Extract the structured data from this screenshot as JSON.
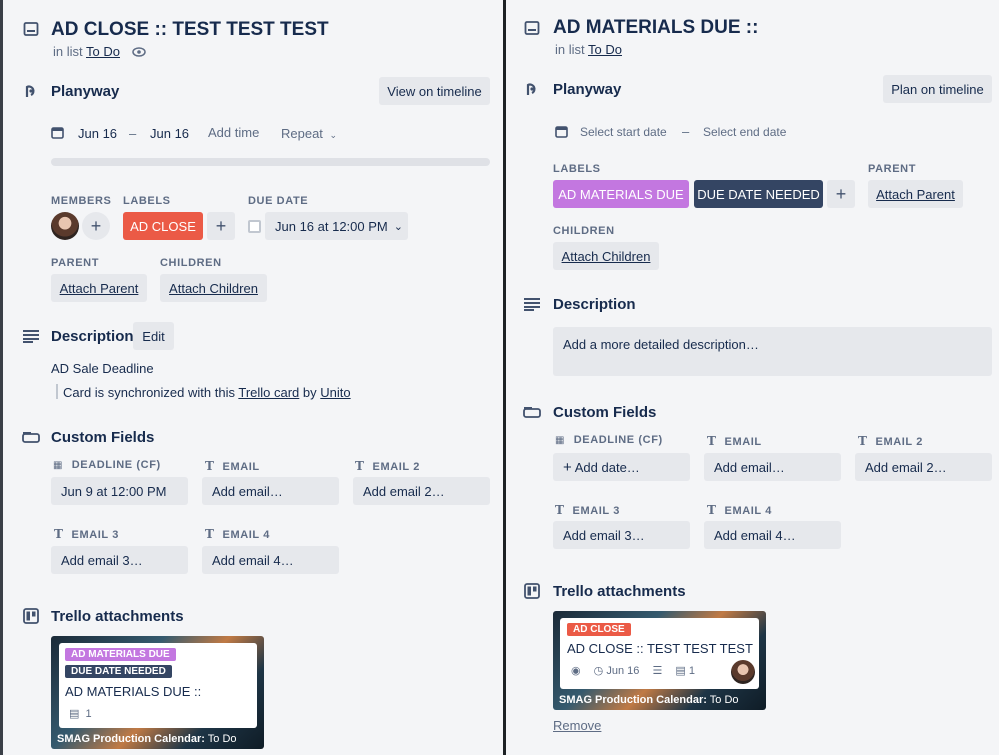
{
  "left": {
    "title": "AD CLOSE :: TEST TEST TEST",
    "in_list_prefix": "in list",
    "list_name": "To Do",
    "planyway": {
      "heading": "Planyway",
      "view_button": "View on timeline",
      "start": "Jun 16",
      "dash": "–",
      "end": "Jun 16",
      "add_time": "Add time",
      "repeat": "Repeat"
    },
    "members_label": "MEMBERS",
    "labels_label": "LABELS",
    "due_label": "DUE DATE",
    "label_chip": "AD CLOSE",
    "due_value": "Jun 16 at 12:00 PM",
    "parent_label": "PARENT",
    "children_label": "CHILDREN",
    "attach_parent": "Attach Parent",
    "attach_children": "Attach Children",
    "description": {
      "heading": "Description",
      "edit": "Edit",
      "line1": "AD Sale Deadline",
      "sync_prefix": "Card is synchronized with this",
      "sync_link": "Trello card",
      "sync_by": "by",
      "sync_service": "Unito"
    },
    "custom_fields": {
      "heading": "Custom Fields",
      "deadline_label": "DEADLINE (CF)",
      "deadline_value": "Jun 9 at 12:00 PM",
      "email_label": "EMAIL",
      "email_value": "Add email…",
      "email2_label": "EMAIL 2",
      "email2_value": "Add email 2…",
      "email3_label": "EMAIL 3",
      "email3_value": "Add email 3…",
      "email4_label": "EMAIL 4",
      "email4_value": "Add email 4…"
    },
    "trello": {
      "heading": "Trello attachments",
      "chip1": "AD MATERIALS DUE",
      "chip2": "DUE DATE NEEDED",
      "card_title": "AD MATERIALS DUE ::",
      "count": "1",
      "board": "SMAG Production Calendar:",
      "list": "To Do"
    }
  },
  "right": {
    "title": "AD MATERIALS DUE ::",
    "in_list_prefix": "in list",
    "list_name": "To Do",
    "planyway": {
      "heading": "Planyway",
      "plan_button": "Plan on timeline",
      "start_placeholder": "Select start date",
      "dash": "–",
      "end_placeholder": "Select end date"
    },
    "labels_label": "LABELS",
    "label1": "AD MATERIALS DUE",
    "label2": "DUE DATE NEEDED",
    "parent_label": "PARENT",
    "attach_parent": "Attach Parent",
    "children_label": "CHILDREN",
    "attach_children": "Attach Children",
    "description": {
      "heading": "Description",
      "placeholder": "Add a more detailed description…"
    },
    "custom_fields": {
      "heading": "Custom Fields",
      "deadline_label": "DEADLINE (CF)",
      "deadline_value": "Add date…",
      "email_label": "EMAIL",
      "email_value": "Add email…",
      "email2_label": "EMAIL 2",
      "email2_value": "Add email 2…",
      "email3_label": "EMAIL 3",
      "email3_value": "Add email 3…",
      "email4_label": "EMAIL 4",
      "email4_value": "Add email 4…"
    },
    "trello": {
      "heading": "Trello attachments",
      "chip": "AD CLOSE",
      "card_title": "AD CLOSE :: TEST TEST TEST",
      "date": "Jun 16",
      "count": "1",
      "board": "SMAG Production Calendar:",
      "list": "To Do",
      "remove": "Remove"
    }
  },
  "colors": {
    "ad_close": "#eb5a46",
    "ad_materials": "#c377e0",
    "due_date_needed": "#344563"
  }
}
